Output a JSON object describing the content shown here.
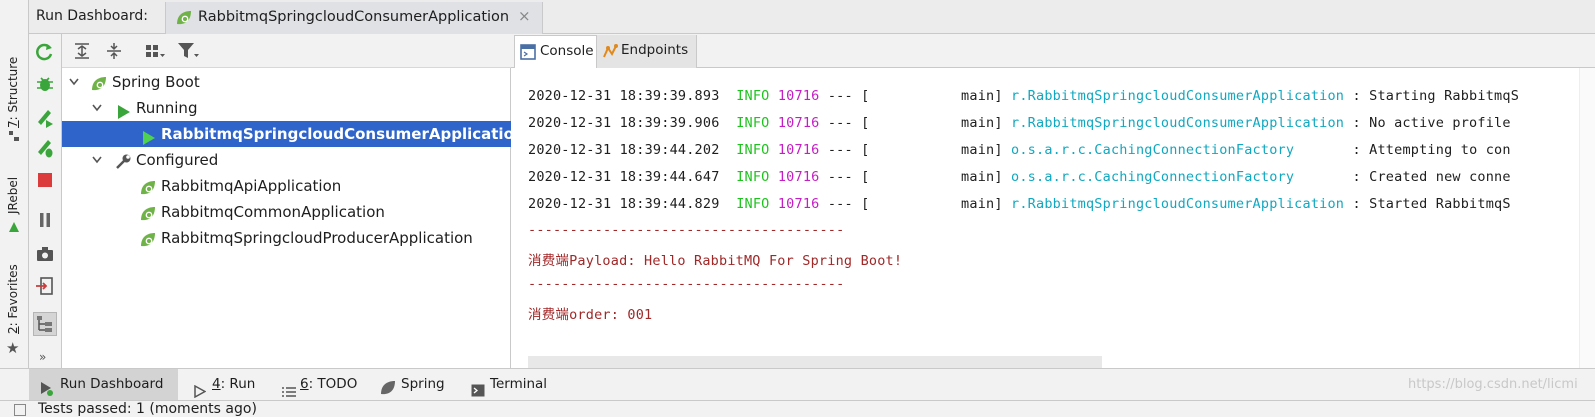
{
  "header": {
    "title": "Run Dashboard:",
    "run_tab": {
      "label": "RabbitmqSpringcloudConsumerApplication",
      "close": "×"
    }
  },
  "left_strip": {
    "structure": {
      "number": "7",
      "label": ": Structure"
    },
    "jrebel": "JRebel",
    "favorites": {
      "number": "2",
      "label": ": Favorites"
    },
    "more": "»"
  },
  "tree": [
    {
      "label": "Spring Boot",
      "kind": "group",
      "icon": "spring-boot-icon",
      "expanded": true
    },
    {
      "label": "Running",
      "kind": "group",
      "icon": "run-triangle-icon",
      "expanded": true
    },
    {
      "label": "RabbitmqSpringcloudConsumerApplication",
      "kind": "app",
      "icon": "run-triangle-icon",
      "selected": true
    },
    {
      "label": "Configured",
      "kind": "group",
      "icon": "wrench-icon",
      "expanded": true
    },
    {
      "label": "RabbitmqApiApplication",
      "kind": "app",
      "icon": "spring-boot-icon"
    },
    {
      "label": "RabbitmqCommonApplication",
      "kind": "app",
      "icon": "spring-boot-icon"
    },
    {
      "label": "RabbitmqSpringcloudProducerApplication",
      "kind": "app",
      "icon": "spring-boot-icon"
    }
  ],
  "console_tabs": {
    "console": "Console",
    "endpoints": "Endpoints"
  },
  "console": {
    "logs": [
      {
        "ts": "2020-12-31 18:39:39.893",
        "level": "INFO",
        "pid": "10716",
        "sep": "--- [",
        "thread": "           main]",
        "logger": "r.RabbitmqSpringcloudConsumerApplication",
        "msg": ": Starting RabbitmqS"
      },
      {
        "ts": "2020-12-31 18:39:39.906",
        "level": "INFO",
        "pid": "10716",
        "sep": "--- [",
        "thread": "           main]",
        "logger": "r.RabbitmqSpringcloudConsumerApplication",
        "msg": ": No active profile"
      },
      {
        "ts": "2020-12-31 18:39:44.202",
        "level": "INFO",
        "pid": "10716",
        "sep": "--- [",
        "thread": "           main]",
        "logger": "o.s.a.r.c.CachingConnectionFactory",
        "msg": ": Attempting to con"
      },
      {
        "ts": "2020-12-31 18:39:44.647",
        "level": "INFO",
        "pid": "10716",
        "sep": "--- [",
        "thread": "           main]",
        "logger": "o.s.a.r.c.CachingConnectionFactory",
        "msg": ": Created new conne"
      },
      {
        "ts": "2020-12-31 18:39:44.829",
        "level": "INFO",
        "pid": "10716",
        "sep": "--- [",
        "thread": "           main]",
        "logger": "r.RabbitmqSpringcloudConsumerApplication",
        "msg": ": Started RabbitmqS"
      }
    ],
    "divider": "--------------------------------------",
    "payload_line": "消费端Payload: Hello RabbitMQ For Spring Boot!",
    "divider2": "--------------------------------------",
    "order_line": "消费端order: 001"
  },
  "bottom_bar": {
    "run_dashboard": "Run Dashboard",
    "run": {
      "mnemonic": "4",
      "label": ": Run"
    },
    "todo": {
      "mnemonic": "6",
      "label": ": TODO"
    },
    "spring": "Spring",
    "terminal": "Terminal"
  },
  "status": "Tests passed: 1 (moments ago)",
  "watermark": "https://blog.csdn.net/licmi",
  "colors": {
    "selection": "#2f65ca",
    "info": "#1ec41e",
    "pid": "#c51dc5",
    "logger": "#10a8c0",
    "stdout_red": "#a02828",
    "run_green": "#3aa53a",
    "spring_green": "#6fb348"
  }
}
